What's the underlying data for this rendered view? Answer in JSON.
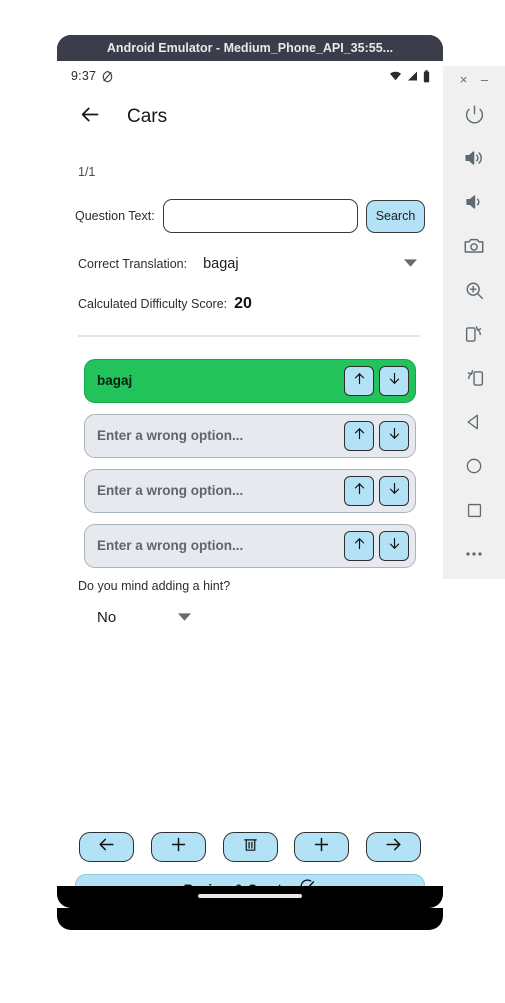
{
  "emulator": {
    "window_title": "Android Emulator - Medium_Phone_API_35:55...",
    "window_controls": [
      {
        "name": "close",
        "glyph": "×"
      },
      {
        "name": "minimize",
        "glyph": "–"
      }
    ],
    "toolbar_items": [
      {
        "name": "power-icon",
        "label": "Power"
      },
      {
        "name": "volume-up-icon",
        "label": "Volume Up"
      },
      {
        "name": "volume-down-icon",
        "label": "Volume Down"
      },
      {
        "name": "camera-icon",
        "label": "Take Screenshot"
      },
      {
        "name": "zoom-icon",
        "label": "Enable Zoom"
      },
      {
        "name": "rotate-left-icon",
        "label": "Rotate Left"
      },
      {
        "name": "rotate-right-icon",
        "label": "Rotate Right"
      },
      {
        "name": "back-triangle-icon",
        "label": "Back"
      },
      {
        "name": "home-circle-icon",
        "label": "Home"
      },
      {
        "name": "overview-square-icon",
        "label": "Overview"
      },
      {
        "name": "more-icon",
        "label": "More"
      }
    ]
  },
  "status_bar": {
    "time": "9:37",
    "left_icons": [
      "do-not-disturb-icon"
    ],
    "right_icons": [
      "wifi-icon",
      "cellular-signal-icon",
      "battery-icon"
    ]
  },
  "app_bar": {
    "back_icon": "arrow-left-icon",
    "title": "Cars"
  },
  "form": {
    "page_counter": "1/1",
    "question_label": "Question Text:",
    "question_value": "",
    "question_placeholder": "",
    "search_label": "Search",
    "translation_label": "Correct Translation:",
    "translation_value": "bagaj",
    "difficulty_label": "Calculated Difficulty Score:",
    "difficulty_value": "20"
  },
  "options": [
    {
      "text": "bagaj",
      "kind": "correct",
      "move_up": "arrow-up-icon",
      "move_down": "arrow-down-icon"
    },
    {
      "text": "Enter a wrong option...",
      "kind": "wrong",
      "move_up": "arrow-up-icon",
      "move_down": "arrow-down-icon"
    },
    {
      "text": "Enter a wrong option...",
      "kind": "wrong",
      "move_up": "arrow-up-icon",
      "move_down": "arrow-down-icon"
    },
    {
      "text": "Enter a wrong option...",
      "kind": "wrong",
      "move_up": "arrow-up-icon",
      "move_down": "arrow-down-icon"
    }
  ],
  "hint": {
    "question": "Do you mind adding a hint?",
    "selected": "No"
  },
  "bottom_actions": {
    "buttons": [
      {
        "name": "previous-button",
        "icon": "arrow-left-icon"
      },
      {
        "name": "add-before-button",
        "icon": "plus-icon"
      },
      {
        "name": "delete-button",
        "icon": "trash-icon"
      },
      {
        "name": "add-after-button",
        "icon": "plus-icon"
      },
      {
        "name": "next-button",
        "icon": "arrow-right-icon"
      }
    ],
    "review_label": "Review & Create",
    "review_icon": "check-circle-icon"
  },
  "colors": {
    "accent_blue": "#b3e2f7",
    "correct_green": "#22c35b",
    "wrong_gray": "#e6eaee",
    "titlebar": "#3b3e4a",
    "toolbar_bg": "#f0f0f0"
  }
}
